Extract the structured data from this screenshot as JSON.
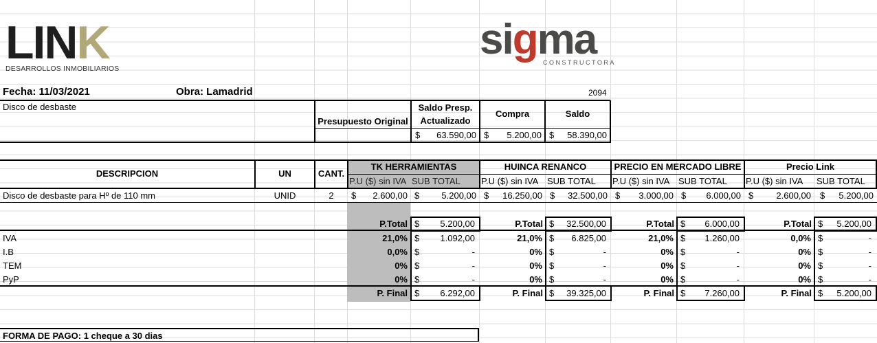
{
  "logos": {
    "link": {
      "word_main": "LIN",
      "word_accent": "K",
      "subtitle": "DESARROLLOS INMOBILIARIOS",
      "accent_color": "#b2a877"
    },
    "sigma": {
      "word_a": "si",
      "word_g": "g",
      "word_b": "ma",
      "subtitle": "CONSTRUCTORA",
      "accent_color": "#c0392b"
    }
  },
  "header": {
    "fecha": "Fecha: 11/03/2021",
    "obra": "Obra: Lamadrid",
    "number": "2094",
    "item": "Disco de desbaste"
  },
  "budget": {
    "col_original": "Presupuesto Original",
    "col_saldo_l1": "Saldo Presp.",
    "col_saldo_l2": "Actualizado",
    "col_compra": "Compra",
    "col_saldo": "Saldo",
    "cur": "$",
    "saldo_act": "63.590,00",
    "compra": "5.200,00",
    "saldo": "58.390,00"
  },
  "table": {
    "h_desc": "DESCRIPCION",
    "h_un": "UN",
    "h_cant": "CANT.",
    "vendors": [
      "TK HERRAMIENTAS",
      "HUINCA RENANCO",
      "PRECIO EN MERCADO LIBRE",
      "Precio Link"
    ],
    "h_pu": "P.U ($) sin IVA",
    "h_sub": "SUB TOTAL",
    "row_desc": "Disco de desbaste para Hº de 110 mm",
    "row_un": "UNID",
    "row_cant": "2",
    "pu": [
      "2.600,00",
      "16.250,00",
      "3.000,00",
      "2.600,00"
    ],
    "sub": [
      "5.200,00",
      "32.500,00",
      "6.000,00",
      "5.200,00"
    ]
  },
  "totals": {
    "ptotal_label": "P.Total",
    "pfinal_label": "P. Final",
    "ptotal": [
      "5.200,00",
      "32.500,00",
      "6.000,00",
      "5.200,00"
    ],
    "rows": [
      {
        "label": "IVA",
        "pct": [
          "21,0%",
          "21,0%",
          "21,0%",
          "0,0%"
        ],
        "val": [
          "1.092,00",
          "6.825,00",
          "1.260,00",
          "-"
        ]
      },
      {
        "label": "I.B",
        "pct": [
          "0,0%",
          "0%",
          "0%",
          "0%"
        ],
        "val": [
          "-",
          "-",
          "-",
          "-"
        ]
      },
      {
        "label": "TEM",
        "pct": [
          "0%",
          "0%",
          "0%",
          "0%"
        ],
        "val": [
          "-",
          "-",
          "-",
          "-"
        ]
      },
      {
        "label": "PyP",
        "pct": [
          "0%",
          "0%",
          "0%",
          "0%"
        ],
        "val": [
          "-",
          "-",
          "-",
          "-"
        ]
      }
    ],
    "pfinal": [
      "6.292,00",
      "39.325,00",
      "7.260,00",
      "5.200,00"
    ]
  },
  "footer": {
    "forma_pago": "FORMA DE PAGO: 1 cheque a 30 dias"
  }
}
